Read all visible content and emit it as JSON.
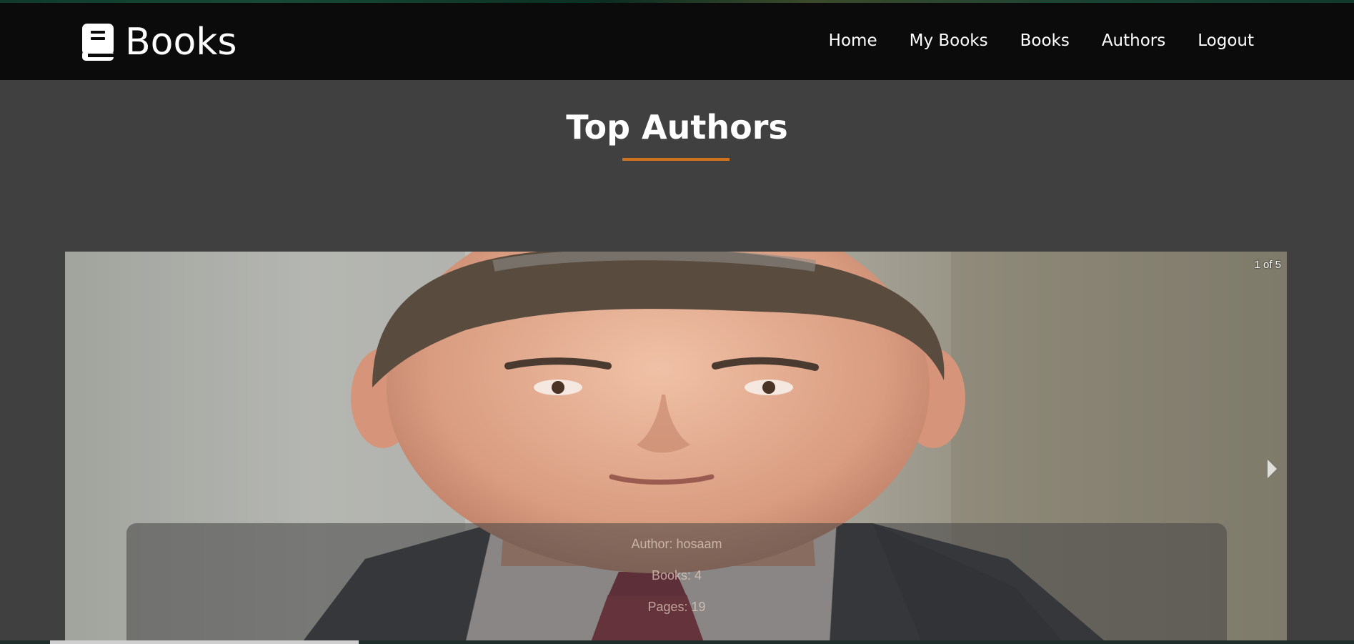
{
  "brand": {
    "name": "Books",
    "icon": "book-icon"
  },
  "nav": {
    "home": "Home",
    "my_books": "My Books",
    "books": "Books",
    "authors": "Authors",
    "logout": "Logout"
  },
  "section": {
    "title": "Top Authors",
    "accent_color": "#d0721c"
  },
  "carousel": {
    "counter": "1 of 5",
    "next_icon": "chevron-right-icon",
    "slide": {
      "author": "Author: hosaam",
      "books": "Books: 4",
      "pages": "Pages: 19"
    }
  },
  "colors": {
    "header_bg": "#0b0b0b",
    "page_bg": "#404040"
  }
}
